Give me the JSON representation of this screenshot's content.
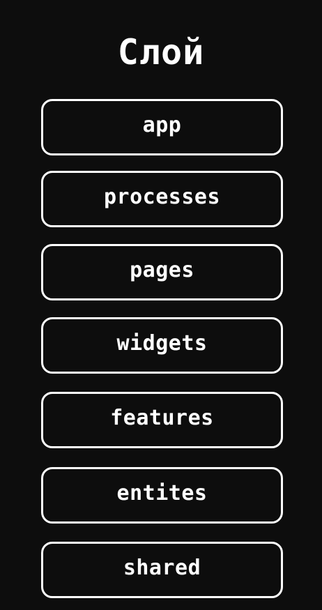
{
  "header": {
    "title": "Слой"
  },
  "layers": [
    {
      "label": "app"
    },
    {
      "label": "processes"
    },
    {
      "label": "pages"
    },
    {
      "label": "widgets"
    },
    {
      "label": "features"
    },
    {
      "label": "entites"
    },
    {
      "label": "shared"
    }
  ],
  "colors": {
    "background": "#0d0d0d",
    "foreground": "#ffffff"
  }
}
